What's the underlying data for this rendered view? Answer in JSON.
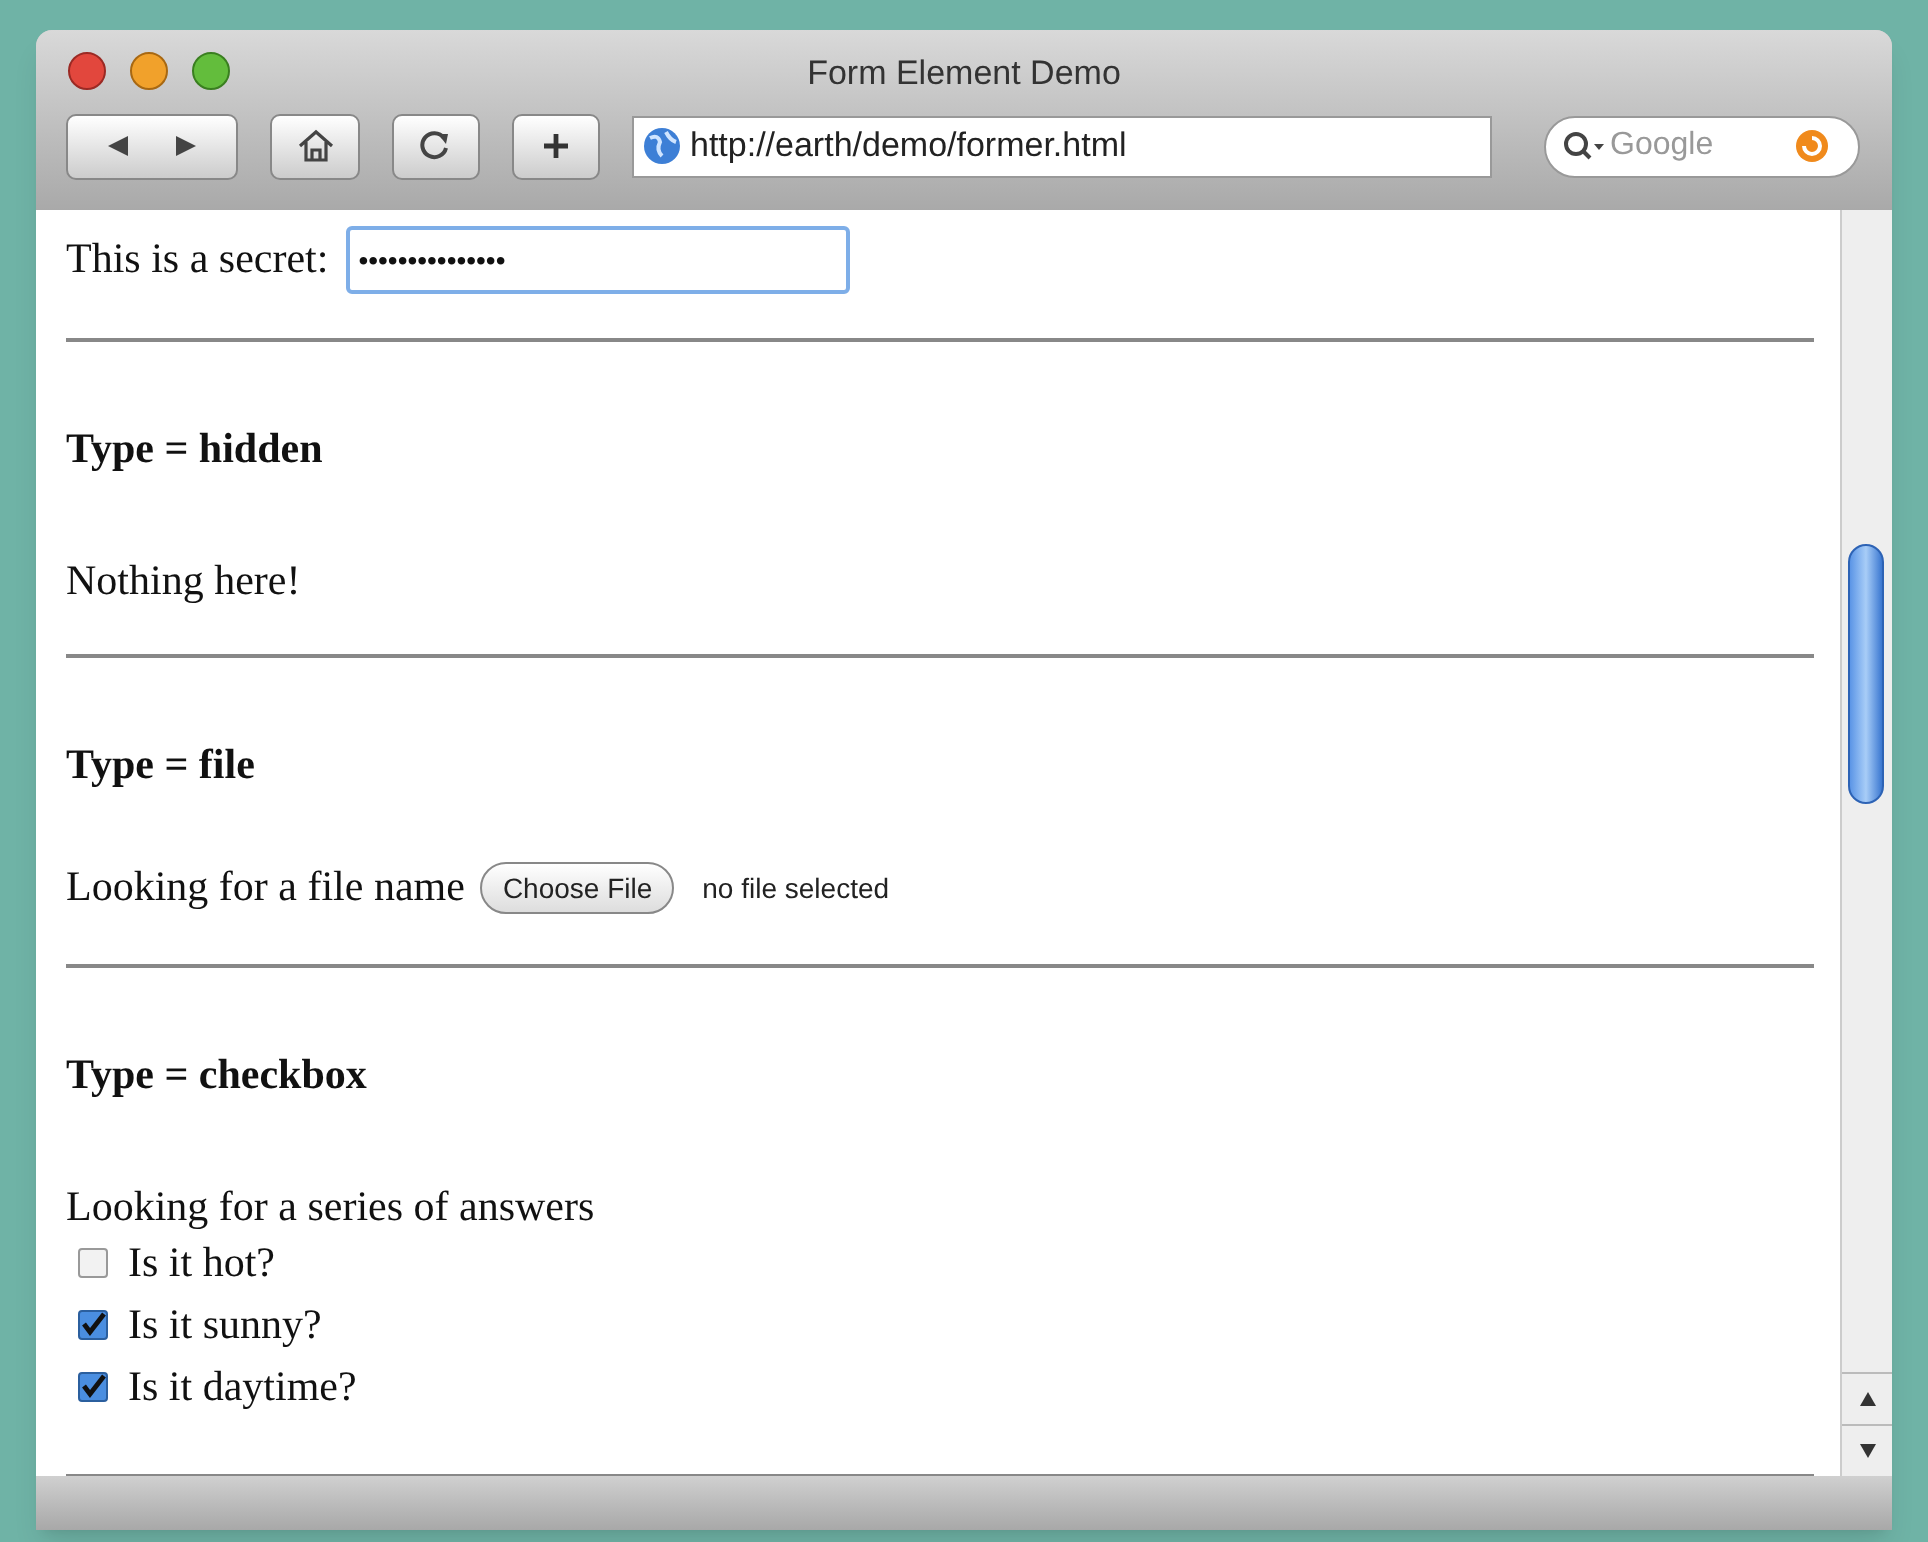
{
  "window": {
    "title": "Form Element Demo"
  },
  "toolbar": {
    "address": "http://earth/demo/former.html",
    "search_placeholder": "Google"
  },
  "password": {
    "label": "This is a secret:",
    "value": "•••••••••••••••"
  },
  "sections": [
    {
      "kind": "text",
      "heading": "Type = hidden",
      "text": "Nothing here!"
    },
    {
      "kind": "file",
      "heading": "Type = file",
      "label": "Looking for a file name",
      "button": "Choose File",
      "status": "no file selected"
    },
    {
      "kind": "checkbox",
      "heading": "Type = checkbox",
      "prompt": "Looking for a series of answers",
      "options": [
        {
          "label": "Is it hot?",
          "checked": false
        },
        {
          "label": "Is it sunny?",
          "checked": true
        },
        {
          "label": "Is it daytime?",
          "checked": true
        }
      ]
    }
  ]
}
